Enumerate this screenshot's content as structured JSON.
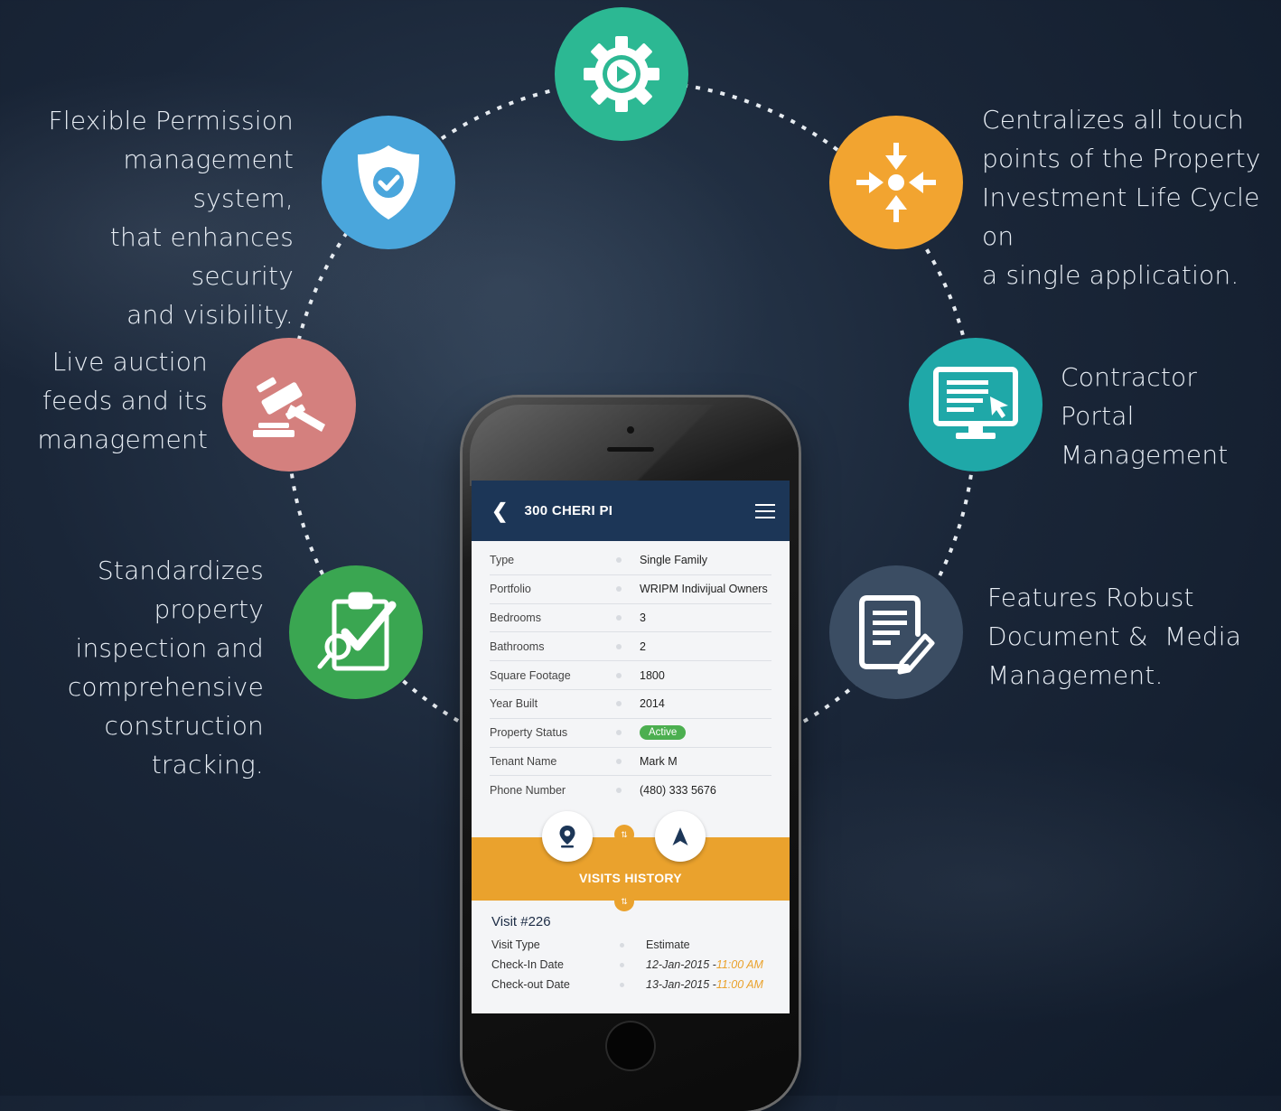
{
  "features": {
    "permission": [
      "Flexible Permission",
      "management system,",
      "that enhances security",
      "and visibility."
    ],
    "centralizes": [
      "Centralizes all touch",
      "points of the Property",
      "Investment Life Cycle on",
      "a single application."
    ],
    "auction": [
      "Live auction",
      "feeds and its",
      "management"
    ],
    "contractor": [
      "Contractor Portal",
      "Management"
    ],
    "inspection": [
      "Standardizes property",
      "inspection and",
      "comprehensive",
      "construction tracking."
    ],
    "documents": [
      "Features Robust",
      "Document &  Media",
      "Management."
    ]
  },
  "colors": {
    "play": "#2cb893",
    "shield": "#4aa6dc",
    "arrows": "#f2a430",
    "gavel": "#d4807e",
    "monitor": "#1fa8a8",
    "clipboard": "#3aa651",
    "document": "#3b4d63",
    "app_header": "#1c3657",
    "accent_orange": "#eaa22d"
  },
  "icons": [
    "gear-play-icon",
    "shield-check-icon",
    "converge-arrows-icon",
    "gavel-icon",
    "monitor-cursor-icon",
    "clipboard-check-icon",
    "document-edit-icon"
  ],
  "app": {
    "back_glyph": "❮",
    "title": "300 CHERI PI",
    "details": [
      {
        "label": "Type",
        "value": "Single Family"
      },
      {
        "label": "Portfolio",
        "value": "WRIPM Indivijual Owners"
      },
      {
        "label": "Bedrooms",
        "value": "3"
      },
      {
        "label": "Bathrooms",
        "value": "2"
      },
      {
        "label": "Square Footage",
        "value": "1800"
      },
      {
        "label": "Year Built",
        "value": "2014"
      },
      {
        "label": "Property Status",
        "value": "Active"
      },
      {
        "label": "Tenant Name",
        "value": "Mark M"
      },
      {
        "label": "Phone Number",
        "value": "(480) 333 5676"
      }
    ],
    "visits_label": "VISITS HISTORY",
    "visit": {
      "title": "Visit #226",
      "rows": [
        {
          "label": "Visit Type",
          "value": "Estimate",
          "time": ""
        },
        {
          "label": "Check-In Date",
          "value": "12-Jan-2015 - ",
          "time": "11:00 AM"
        },
        {
          "label": "Check-out Date",
          "value": "13-Jan-2015 - ",
          "time": "11:00 AM"
        }
      ]
    },
    "swap_glyph": "⇅"
  }
}
